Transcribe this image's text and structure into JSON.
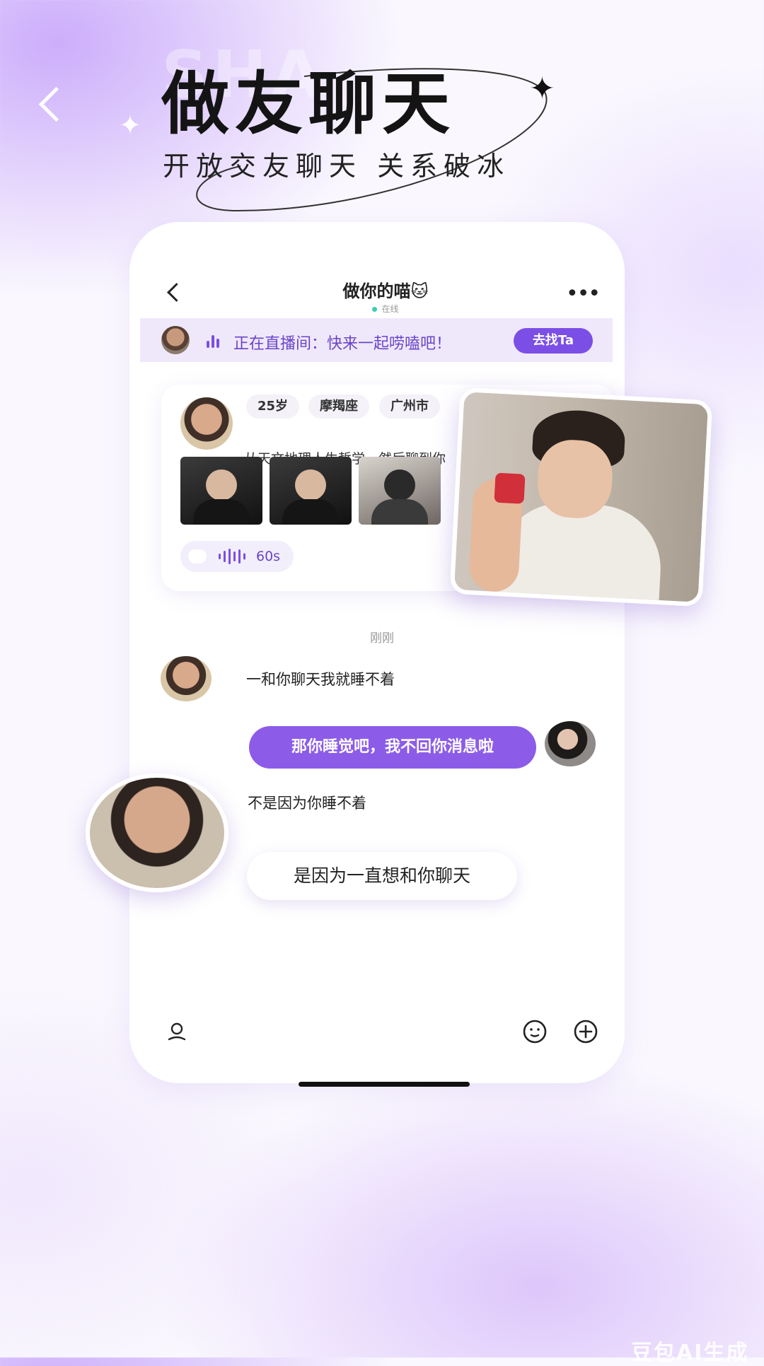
{
  "header": {
    "watermark": "SHA",
    "title": "做友聊天",
    "subtitle": "开放交友聊天 关系破冰"
  },
  "chat": {
    "title": "做你的喵🐱",
    "status": "在线"
  },
  "live_banner": {
    "text": "正在直播间：快来一起唠嗑吧！",
    "button": "去找Ta",
    "accent": "#7b4ee6"
  },
  "profile": {
    "tags": [
      "25岁",
      "摩羯座",
      "广州市"
    ],
    "bio": "从天文地理人生哲学，然后聊到你",
    "voice_duration": "60s"
  },
  "messages": {
    "time": "刚刚",
    "m1": "一和你聊天我就睡不着",
    "m2": "那你睡觉吧，我不回你消息啦",
    "m3": "不是因为你睡不着",
    "m4": "是因为一直想和你聊天"
  },
  "icons": {
    "back": "chevron-left-icon",
    "more": "more-icon",
    "mic": "voice-icon",
    "emoji": "emoji-icon",
    "plus": "plus-icon"
  },
  "footer": {
    "watermark": "豆包AI生成"
  }
}
